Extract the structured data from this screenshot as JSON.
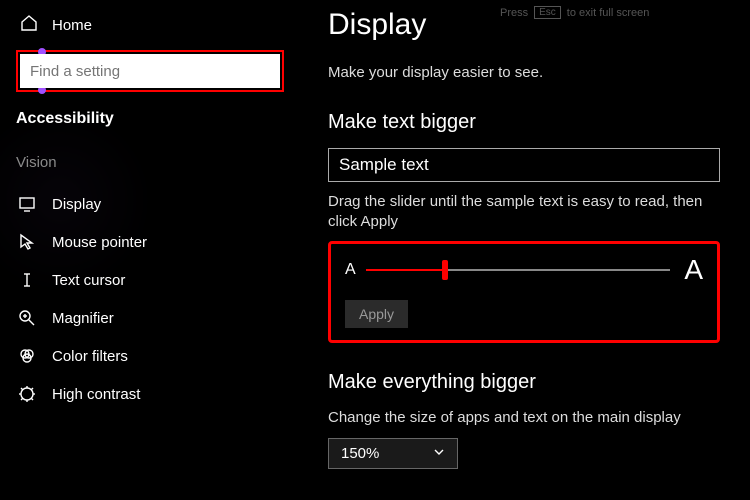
{
  "sidebar": {
    "home": "Home",
    "search_placeholder": "Find a setting",
    "category": "Accessibility",
    "group": "Vision",
    "items": [
      {
        "label": "Display"
      },
      {
        "label": "Mouse pointer"
      },
      {
        "label": "Text cursor"
      },
      {
        "label": "Magnifier"
      },
      {
        "label": "Color filters"
      },
      {
        "label": "High contrast"
      }
    ]
  },
  "hint_bar": {
    "press": "Press",
    "esc": "Esc",
    "rest": "to exit full screen"
  },
  "main": {
    "title": "Display",
    "subtitle": "Make your display easier to see.",
    "text_bigger": {
      "heading": "Make text bigger",
      "sample": "Sample text",
      "instruction": "Drag the slider until the sample text is easy to read, then click Apply",
      "small_a": "A",
      "big_a": "A",
      "apply": "Apply"
    },
    "everything_bigger": {
      "heading": "Make everything bigger",
      "instruction": "Change the size of apps and text on the main display",
      "value": "150%"
    }
  }
}
